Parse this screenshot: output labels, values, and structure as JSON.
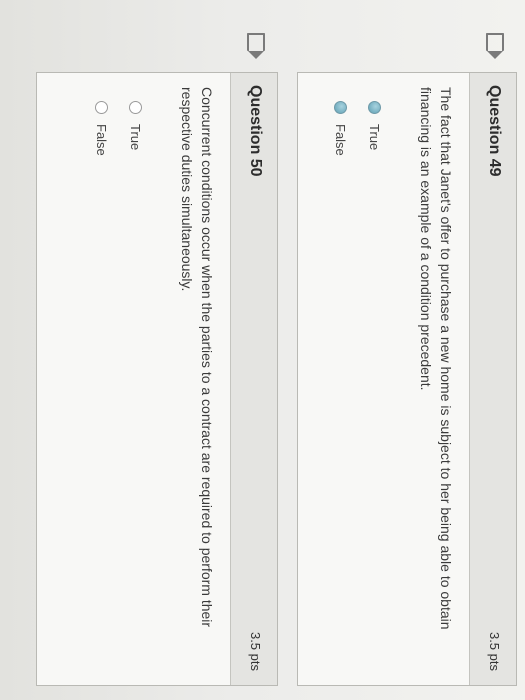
{
  "questions": [
    {
      "title": "Question 49",
      "points": "3.5 pts",
      "text": "The fact that Janet's offer to purchase a new home is subject to her being able to obtain financing is an example of a condition precedent.",
      "options": [
        "True",
        "False"
      ]
    },
    {
      "title": "Question 50",
      "points": "3.5 pts",
      "text": "Concurrent conditions occur when the parties to a contract are required to perform their respective duties simultaneously.",
      "options": [
        "True",
        "False"
      ]
    }
  ],
  "colors": {
    "background": "#e7e7e4",
    "card": "#f8f8f6",
    "header": "#e4e4e1",
    "radio_accent": "#5e9fb3"
  },
  "icons": [
    "flag-icon"
  ]
}
